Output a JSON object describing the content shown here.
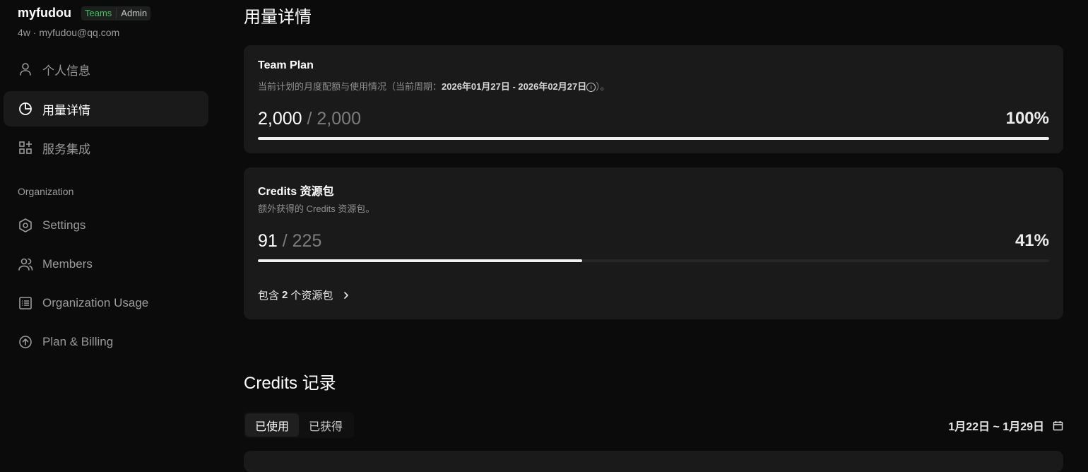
{
  "user": {
    "name": "myfudou",
    "badge_plan": "Teams",
    "badge_role": "Admin",
    "subline": "4w · myfudou@qq.com"
  },
  "nav": {
    "personal": {
      "label": "个人信息",
      "icon": "user-icon"
    },
    "usage": {
      "label": "用量详情",
      "icon": "pie-chart-icon"
    },
    "integrations": {
      "label": "服务集成",
      "icon": "grid-plus-icon"
    }
  },
  "org": {
    "section_title": "Organization",
    "settings": {
      "label": "Settings",
      "icon": "hexagon-gear-icon"
    },
    "members": {
      "label": "Members",
      "icon": "users-icon"
    },
    "usage": {
      "label": "Organization Usage",
      "icon": "list-icon"
    },
    "billing": {
      "label": "Plan & Billing",
      "icon": "arrow-up-circle-icon"
    }
  },
  "main": {
    "title": "用量详情",
    "team_plan": {
      "title": "Team Plan",
      "desc_prefix": "当前计划的月度配额与使用情况（当前周期：",
      "period": "2026年01月27日 - 2026年02月27日",
      "desc_suffix": "）。",
      "used": "2,000",
      "total": "/ 2,000",
      "percent": "100%",
      "fraction": 1.0
    },
    "credits_pack": {
      "title": "Credits 资源包",
      "desc": "额外获得的 Credits 资源包。",
      "used": "91",
      "total": "/ 225",
      "percent": "41%",
      "fraction": 0.41,
      "packs_prefix": "包含",
      "packs_count": "2",
      "packs_suffix": "个资源包"
    },
    "credits_records": {
      "title": "Credits 记录",
      "tabs": [
        "已使用",
        "已获得"
      ],
      "active_tab": 0,
      "date_range": "1月22日 ~ 1月29日"
    }
  },
  "colors": {
    "background": "#0b0b0c",
    "card": "#1a1a1a",
    "teams_badge": "#3fc25e",
    "bar_fill": "#f0f0f0"
  }
}
